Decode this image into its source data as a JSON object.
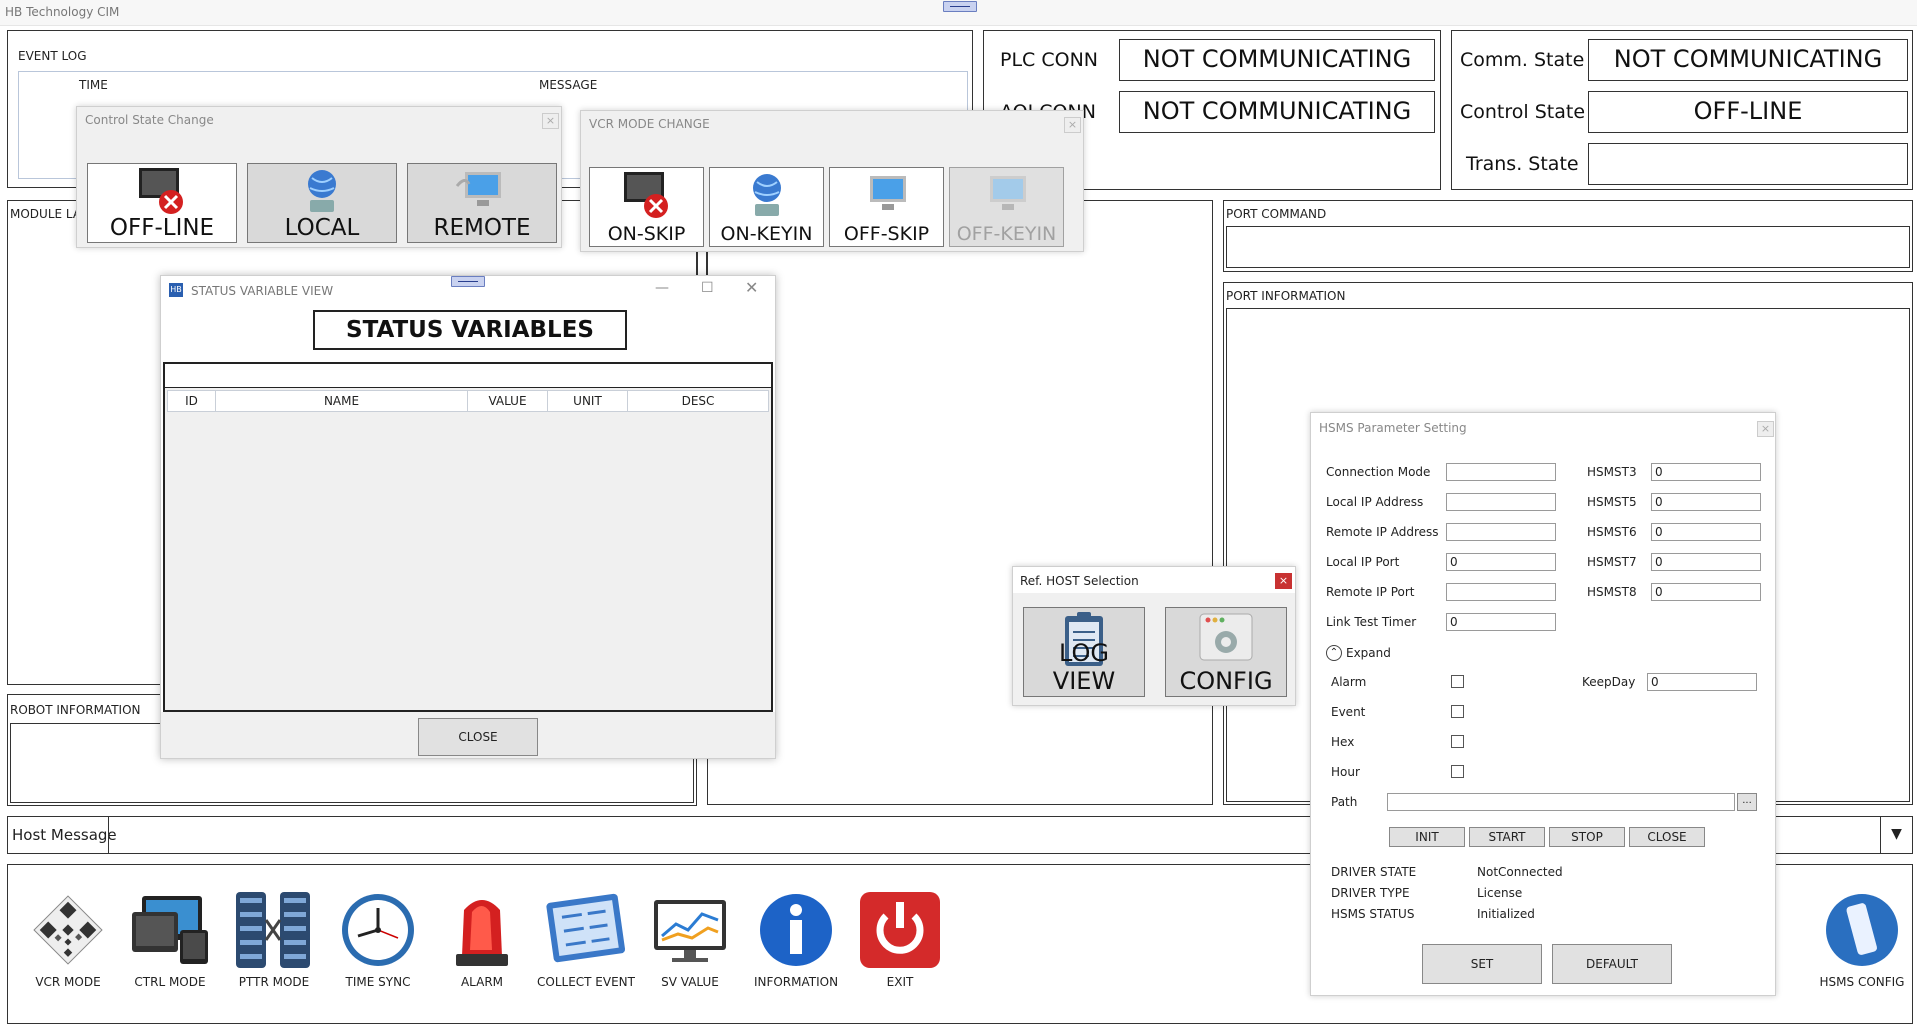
{
  "app": {
    "title": "HB Technology CIM"
  },
  "event_log": {
    "label": "EVENT LOG",
    "col_time": "TIME",
    "col_message": "MESSAGE"
  },
  "conn": {
    "plc_label": "PLC CONN",
    "plc_value": "NOT COMMUNICATING",
    "aoi_label": "AOI CONN",
    "aoi_value": "NOT COMMUNICATING"
  },
  "states": {
    "comm_label": "Comm. State",
    "comm_value": "NOT COMMUNICATING",
    "control_label": "Control State",
    "control_value": "OFF-LINE",
    "trans_label": "Trans. State",
    "trans_value": ""
  },
  "sections": {
    "module_layout": "MODULE LA",
    "robot_info": "ROBOT INFORMATION",
    "port_command": "PORT COMMAND",
    "port_info": "PORT INFORMATION"
  },
  "control_state_change": {
    "title": "Control State Change",
    "buttons": [
      "OFF-LINE",
      "LOCAL",
      "REMOTE"
    ]
  },
  "vcr_mode_change": {
    "title": "VCR MODE CHANGE",
    "buttons": [
      "ON-SKIP",
      "ON-KEYIN",
      "OFF-SKIP",
      "OFF-KEYIN"
    ]
  },
  "status_view": {
    "title": "STATUS VARIABLE VIEW",
    "heading": "STATUS VARIABLES",
    "columns": [
      "ID",
      "NAME",
      "VALUE",
      "UNIT",
      "DESC"
    ],
    "close_label": "CLOSE"
  },
  "host_selection": {
    "title": "Ref. HOST Selection",
    "log_view": "LOG VIEW",
    "config": "CONFIG"
  },
  "hsms": {
    "title": "HSMS Parameter Setting",
    "left_fields": [
      {
        "label": "Connection Mode",
        "value": ""
      },
      {
        "label": "Local IP Address",
        "value": ""
      },
      {
        "label": "Remote IP Address",
        "value": ""
      },
      {
        "label": "Local IP Port",
        "value": "0"
      },
      {
        "label": "Remote IP Port",
        "value": ""
      },
      {
        "label": "Link Test Timer",
        "value": "0"
      }
    ],
    "right_fields": [
      {
        "label": "HSMST3",
        "value": "0"
      },
      {
        "label": "HSMST5",
        "value": "0"
      },
      {
        "label": "HSMST6",
        "value": "0"
      },
      {
        "label": "HSMST7",
        "value": "0"
      },
      {
        "label": "HSMST8",
        "value": "0"
      }
    ],
    "expand": "Expand",
    "checks": [
      "Alarm",
      "Event",
      "Hex",
      "Hour"
    ],
    "keepday_label": "KeepDay",
    "keepday_value": "0",
    "path_label": "Path",
    "path_value": "",
    "browse": "...",
    "actions": [
      "INIT",
      "START",
      "STOP",
      "CLOSE"
    ],
    "info": [
      {
        "label": "DRIVER STATE",
        "value": "NotConnected"
      },
      {
        "label": "DRIVER TYPE",
        "value": "License"
      },
      {
        "label": "HSMS STATUS",
        "value": "Initialized"
      }
    ],
    "set": "SET",
    "default": "DEFAULT"
  },
  "host_message": {
    "label": "Host Message",
    "value": ""
  },
  "toolbar": [
    {
      "label": "VCR MODE",
      "icon": "qr-code-icon"
    },
    {
      "label": "CTRL MODE",
      "icon": "monitors-icon"
    },
    {
      "label": "PTTR MODE",
      "icon": "servers-icon"
    },
    {
      "label": "TIME SYNC",
      "icon": "clock-icon"
    },
    {
      "label": "ALARM",
      "icon": "siren-icon"
    },
    {
      "label": "COLLECT EVENT",
      "icon": "checklist-icon"
    },
    {
      "label": "SV VALUE",
      "icon": "chart-monitor-icon"
    },
    {
      "label": "INFORMATION",
      "icon": "info-icon"
    },
    {
      "label": "EXIT",
      "icon": "power-icon"
    }
  ],
  "hsms_config": {
    "label": "HSMS CONFIG",
    "icon": "phone-icon"
  }
}
